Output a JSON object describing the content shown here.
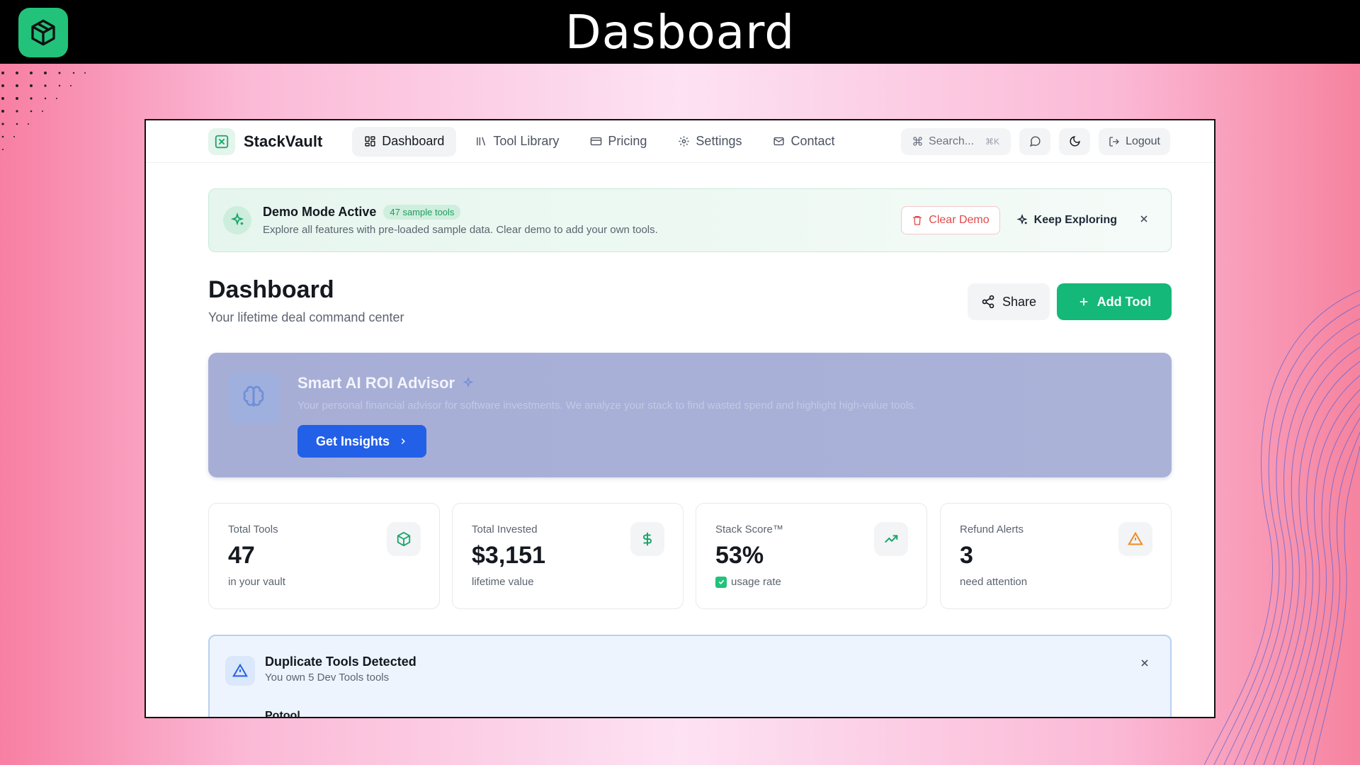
{
  "banner": {
    "title": "Dasboard"
  },
  "nav": {
    "brand": "StackVault",
    "items": [
      {
        "label": "Dashboard",
        "icon": "dashboard-icon",
        "active": true
      },
      {
        "label": "Tool Library",
        "icon": "library-icon",
        "active": false
      },
      {
        "label": "Pricing",
        "icon": "card-icon",
        "active": false
      },
      {
        "label": "Settings",
        "icon": "gear-icon",
        "active": false
      },
      {
        "label": "Contact",
        "icon": "mail-icon",
        "active": false
      }
    ],
    "search_placeholder": "Search...",
    "search_shortcut": "⌘K",
    "logout": "Logout"
  },
  "demo": {
    "title": "Demo Mode Active",
    "badge": "47 sample tools",
    "description": "Explore all features with pre-loaded sample data. Clear demo to add your own tools.",
    "clear_label": "Clear Demo",
    "keep_label": "Keep Exploring"
  },
  "header": {
    "title": "Dashboard",
    "subtitle": "Your lifetime deal command center",
    "share": "Share",
    "add_tool": "Add Tool"
  },
  "advisor": {
    "title": "Smart AI ROI Advisor",
    "description": "Your personal financial advisor for software investments. We analyze your stack to find wasted spend and highlight high-value tools.",
    "button": "Get Insights"
  },
  "stats": [
    {
      "label": "Total Tools",
      "value": "47",
      "sub": "in your vault",
      "icon": "box-icon",
      "color": "#1aa56a"
    },
    {
      "label": "Total Invested",
      "value": "$3,151",
      "sub": "lifetime value",
      "icon": "dollar-icon",
      "color": "#1aa56a"
    },
    {
      "label": "Stack Score™",
      "value": "53%",
      "sub": "usage rate",
      "icon": "trending-up-icon",
      "color": "#1aa56a"
    },
    {
      "label": "Refund Alerts",
      "value": "3",
      "sub": "need attention",
      "icon": "warning-icon",
      "color": "#f08a24"
    }
  ],
  "duplicate": {
    "title": "Duplicate Tools Detected",
    "subtitle": "You own 5 Dev Tools tools",
    "first_item": "Potool"
  },
  "colors": {
    "accent": "#14b878",
    "primary_blue": "#2360e8",
    "danger": "#e04b4b"
  }
}
